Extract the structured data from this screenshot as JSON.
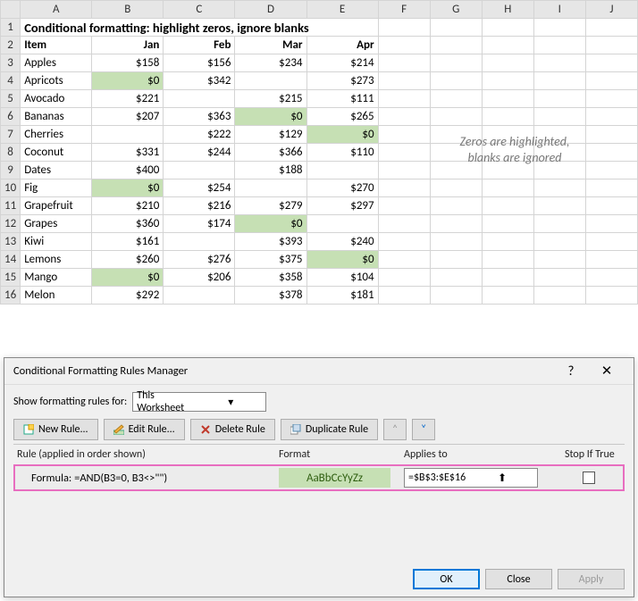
{
  "columns": [
    "A",
    "B",
    "C",
    "D",
    "E",
    "F",
    "G",
    "H",
    "I",
    "J"
  ],
  "row_numbers": [
    "1",
    "2",
    "3",
    "4",
    "5",
    "6",
    "7",
    "8",
    "9",
    "10",
    "11",
    "12",
    "13",
    "14",
    "15",
    "16"
  ],
  "title": "Conditional formatting: highlight zeros, ignore blanks",
  "headers": {
    "item": "Item",
    "jan": "Jan",
    "feb": "Feb",
    "mar": "Mar",
    "apr": "Apr"
  },
  "rows": [
    {
      "item": "Apples",
      "jan": "$158",
      "feb": "$156",
      "mar": "$234",
      "apr": "$214",
      "hz": []
    },
    {
      "item": "Apricots",
      "jan": "$0",
      "feb": "$342",
      "mar": "",
      "apr": "$273",
      "hz": [
        "jan"
      ]
    },
    {
      "item": "Avocado",
      "jan": "$221",
      "feb": "",
      "mar": "$215",
      "apr": "$111",
      "hz": []
    },
    {
      "item": "Bananas",
      "jan": "$207",
      "feb": "$363",
      "mar": "$0",
      "apr": "$265",
      "hz": [
        "mar"
      ]
    },
    {
      "item": "Cherries",
      "jan": "",
      "feb": "$222",
      "mar": "$129",
      "apr": "$0",
      "hz": [
        "apr"
      ]
    },
    {
      "item": "Coconut",
      "jan": "$331",
      "feb": "$244",
      "mar": "$366",
      "apr": "$110",
      "hz": []
    },
    {
      "item": "Dates",
      "jan": "$400",
      "feb": "",
      "mar": "$188",
      "apr": "",
      "hz": []
    },
    {
      "item": "Fig",
      "jan": "$0",
      "feb": "$254",
      "mar": "",
      "apr": "$270",
      "hz": [
        "jan"
      ]
    },
    {
      "item": "Grapefruit",
      "jan": "$210",
      "feb": "$216",
      "mar": "$279",
      "apr": "$297",
      "hz": []
    },
    {
      "item": "Grapes",
      "jan": "$360",
      "feb": "$174",
      "mar": "$0",
      "apr": "",
      "hz": [
        "mar"
      ]
    },
    {
      "item": "Kiwi",
      "jan": "$161",
      "feb": "",
      "mar": "$393",
      "apr": "$240",
      "hz": []
    },
    {
      "item": "Lemons",
      "jan": "$260",
      "feb": "$276",
      "mar": "$375",
      "apr": "$0",
      "hz": [
        "apr"
      ]
    },
    {
      "item": "Mango",
      "jan": "$0",
      "feb": "$206",
      "mar": "$358",
      "apr": "$104",
      "hz": [
        "jan"
      ]
    },
    {
      "item": "Melon",
      "jan": "$292",
      "feb": "",
      "mar": "$378",
      "apr": "$181",
      "hz": []
    }
  ],
  "note_line1": "Zeros are highlighted,",
  "note_line2": "blanks are ignored",
  "dialog": {
    "title": "Conditional Formatting Rules Manager",
    "help": "?",
    "close": "✕",
    "show_label": "Show formatting rules for:",
    "show_value": "This Worksheet",
    "buttons": {
      "new": "New Rule...",
      "edit": "Edit Rule...",
      "delete": "Delete Rule",
      "duplicate": "Duplicate Rule"
    },
    "cols": {
      "rule": "Rule (applied in order shown)",
      "format": "Format",
      "applies": "Applies to",
      "stop": "Stop If True"
    },
    "rule_text": "Formula: =AND(B3=0, B3<>\"\")",
    "format_preview": "AaBbCcYyZz",
    "applies_to": "=$B$3:$E$16",
    "footer": {
      "ok": "OK",
      "close": "Close",
      "apply": "Apply"
    }
  }
}
